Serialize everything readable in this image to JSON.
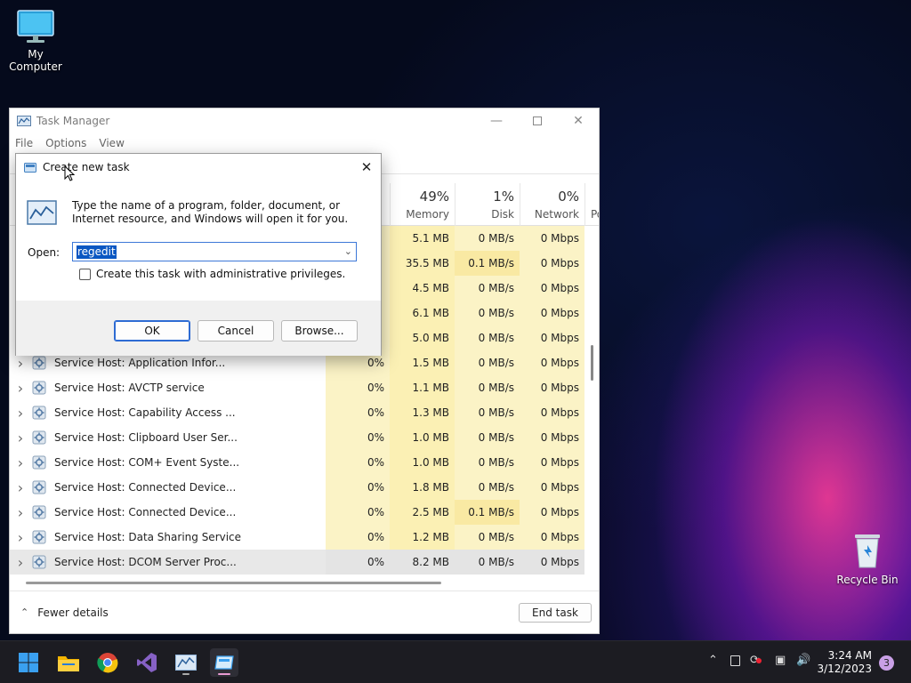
{
  "desktop": {
    "my_computer": "My Computer",
    "recycle_bin": "Recycle Bin"
  },
  "task_manager": {
    "title": "Task Manager",
    "menu": [
      "File",
      "Options",
      "View"
    ],
    "columns": [
      {
        "pct": "49%",
        "name": "Memory"
      },
      {
        "pct": "1%",
        "name": "Disk"
      },
      {
        "pct": "0%",
        "name": "Network"
      },
      {
        "pct": "",
        "name": "Po"
      }
    ],
    "hidden_rows": [
      {
        "mem": "5.1 MB",
        "disk": "0 MB/s",
        "net": "0 Mbps"
      },
      {
        "mem": "35.5 MB",
        "disk": "0.1 MB/s",
        "net": "0 Mbps"
      },
      {
        "mem": "4.5 MB",
        "disk": "0 MB/s",
        "net": "0 Mbps"
      },
      {
        "mem": "6.1 MB",
        "disk": "0 MB/s",
        "net": "0 Mbps"
      },
      {
        "mem": "5.0 MB",
        "disk": "0 MB/s",
        "net": "0 Mbps"
      }
    ],
    "rows": [
      {
        "name": "Service Host: Application Infor...",
        "cpu": "0%",
        "mem": "1.5 MB",
        "disk": "0 MB/s",
        "net": "0 Mbps"
      },
      {
        "name": "Service Host: AVCTP service",
        "cpu": "0%",
        "mem": "1.1 MB",
        "disk": "0 MB/s",
        "net": "0 Mbps"
      },
      {
        "name": "Service Host: Capability Access ...",
        "cpu": "0%",
        "mem": "1.3 MB",
        "disk": "0 MB/s",
        "net": "0 Mbps"
      },
      {
        "name": "Service Host: Clipboard User Ser...",
        "cpu": "0%",
        "mem": "1.0 MB",
        "disk": "0 MB/s",
        "net": "0 Mbps"
      },
      {
        "name": "Service Host: COM+ Event Syste...",
        "cpu": "0%",
        "mem": "1.0 MB",
        "disk": "0 MB/s",
        "net": "0 Mbps"
      },
      {
        "name": "Service Host: Connected Device...",
        "cpu": "0%",
        "mem": "1.8 MB",
        "disk": "0 MB/s",
        "net": "0 Mbps"
      },
      {
        "name": "Service Host: Connected Device...",
        "cpu": "0%",
        "mem": "2.5 MB",
        "disk": "0.1 MB/s",
        "net": "0 Mbps"
      },
      {
        "name": "Service Host: Data Sharing Service",
        "cpu": "0%",
        "mem": "1.2 MB",
        "disk": "0 MB/s",
        "net": "0 Mbps"
      },
      {
        "name": "Service Host: DCOM Server Proc...",
        "cpu": "0%",
        "mem": "8.2 MB",
        "disk": "0 MB/s",
        "net": "0 Mbps"
      }
    ],
    "fewer_details": "Fewer details",
    "end_task": "End task"
  },
  "dialog": {
    "title": "Create new task",
    "description": "Type the name of a program, folder, document, or Internet resource, and Windows will open it for you.",
    "open_label": "Open:",
    "open_value": "regedit",
    "admin_checkbox": "Create this task with administrative privileges.",
    "ok": "OK",
    "cancel": "Cancel",
    "browse": "Browse..."
  },
  "taskbar": {
    "time": "3:24 AM",
    "date": "3/12/2023",
    "notifications": "3"
  }
}
